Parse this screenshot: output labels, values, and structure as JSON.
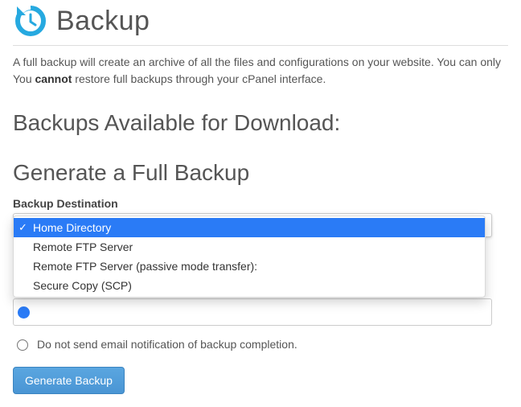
{
  "header": {
    "title": "Backup",
    "icon": "backup-icon"
  },
  "intro": {
    "line1": "A full backup will create an archive of all the files and configurations on your website. You can only",
    "line2_pre": "You ",
    "line2_strong": "cannot",
    "line2_post": " restore full backups through your cPanel interface."
  },
  "sections": {
    "available": "Backups Available for Download:",
    "generate": "Generate a Full Backup"
  },
  "destination": {
    "label": "Backup Destination",
    "selected_index": 0,
    "options": [
      "Home Directory",
      "Remote FTP Server",
      "Remote FTP Server (passive mode transfer):",
      "Secure Copy (SCP)"
    ]
  },
  "email_option": {
    "no_notify_label": "Do not send email notification of backup completion."
  },
  "buttons": {
    "generate": "Generate Backup"
  }
}
